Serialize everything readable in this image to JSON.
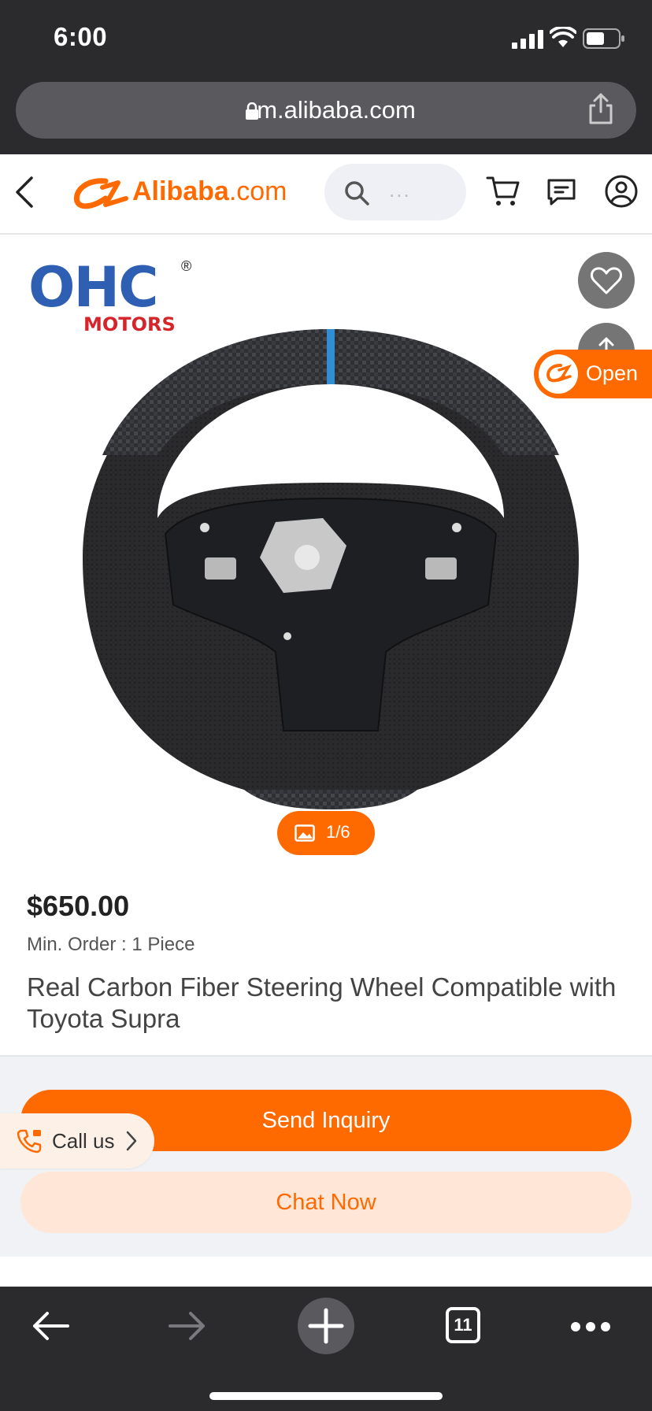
{
  "status": {
    "time": "6:00"
  },
  "browser": {
    "url": "m.alibaba.com",
    "tab_count": "11"
  },
  "header": {
    "logo_text": "Alibaba",
    "logo_suffix": ".com",
    "search_placeholder": "..."
  },
  "product": {
    "brand_main": "OHC",
    "brand_sub": "MOTORS",
    "brand_reg": "®",
    "open_label": "Open",
    "image_counter": "1/6",
    "price": "$650.00",
    "min_order": "Min. Order : 1 Piece",
    "title": "Real Carbon Fiber Steering Wheel Compatible with Toyota Supra"
  },
  "actions": {
    "send_inquiry": "Send Inquiry",
    "chat_now": "Chat Now",
    "call_us": "Call us"
  },
  "colors": {
    "accent": "#ff6a00",
    "brand_blue": "#2f5fb3",
    "brand_red": "#d5252b"
  },
  "icons": [
    "back-icon",
    "search-icon",
    "cart-icon",
    "message-icon",
    "user-icon",
    "heart-icon",
    "share-icon",
    "image-icon",
    "phone-icon",
    "chevron-right-icon",
    "lock-icon",
    "plus-icon",
    "tabs-icon",
    "more-icon"
  ]
}
